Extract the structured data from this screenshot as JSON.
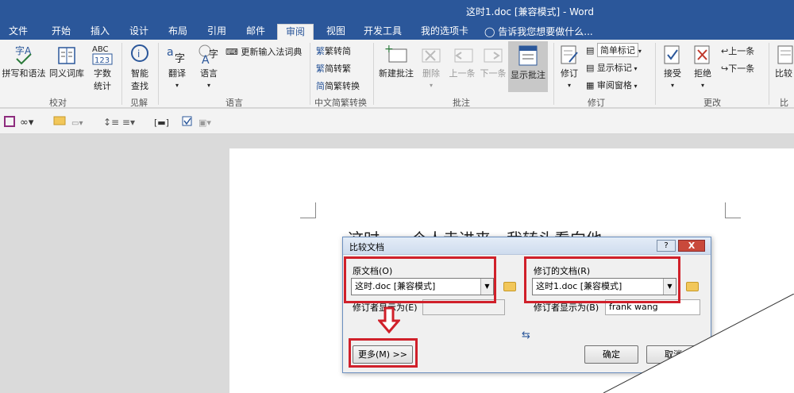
{
  "window": {
    "title": "这时1.doc [兼容模式] - Word"
  },
  "tabs": [
    "文件",
    "开始",
    "插入",
    "设计",
    "布局",
    "引用",
    "邮件",
    "审阅",
    "视图",
    "开发工具",
    "我的选项卡"
  ],
  "active_tab": "审阅",
  "tell_me": "告诉我您想要做什么...",
  "ribbon": {
    "proofing": {
      "spell": "拼写和语法",
      "thesaurus": "同义词库",
      "wordcount_line1": "字数",
      "wordcount_line2": "统计",
      "group": "校对"
    },
    "insights": {
      "smart_line1": "智能",
      "smart_line2": "查找",
      "group": "见解"
    },
    "language": {
      "translate": "翻译",
      "language": "语言",
      "update_ime": "更新输入法词典",
      "group": "语言"
    },
    "chinese": {
      "to_simplified": "繁转简",
      "to_traditional": "简转繁",
      "convert": "简繁转换",
      "group": "中文简繁转换"
    },
    "comments": {
      "new": "新建批注",
      "delete": "删除",
      "prev": "上一条",
      "next": "下一条",
      "show": "显示批注",
      "group": "批注"
    },
    "tracking": {
      "track": "修订",
      "markup_mode": "简单标记",
      "show_markup": "显示标记",
      "review_pane": "审阅窗格",
      "group": "修订"
    },
    "changes": {
      "accept": "接受",
      "reject": "拒绝",
      "prev": "上一条",
      "next": "下一条",
      "group": "更改"
    },
    "compare": {
      "label": "比较",
      "group": "比较"
    }
  },
  "document": {
    "text": "这时，一个人走进来，我转头看向他。"
  },
  "dialog": {
    "title": "比较文档",
    "help": "?",
    "close": "X",
    "original_label": "原文档(O)",
    "original_value": "这时.doc [兼容模式]",
    "revised_label": "修订的文档(R)",
    "revised_value": "这时1.doc [兼容模式]",
    "label_changes_left": "修订者显示为(E)",
    "label_changes_right": "修订者显示为(B)",
    "author_right": "frank wang",
    "more_button": "更多(M) >>",
    "ok_button": "确定",
    "cancel_button": "取消",
    "swap_icon": "⇆"
  },
  "colors": {
    "accent": "#2b579a",
    "highlight": "#d0202a"
  }
}
